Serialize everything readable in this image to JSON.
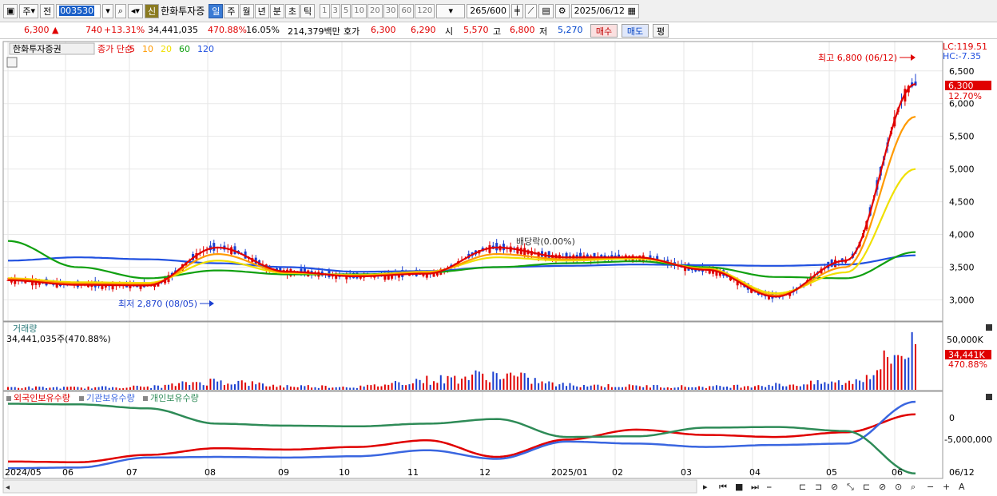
{
  "toolbar": {
    "market": "주",
    "prev_label": "전",
    "stock_code": "003530",
    "stock_badge": "신",
    "stock_name": "한화투자증",
    "periods": [
      "일",
      "주",
      "월",
      "년",
      "분",
      "초",
      "틱"
    ],
    "active_period": "일",
    "intervals": [
      "1",
      "3",
      "5",
      "10",
      "20",
      "30",
      "60",
      "120"
    ],
    "count_current": "265",
    "count_total": "/600",
    "date": "2025/06/12"
  },
  "quote": {
    "price": "6,300",
    "change": "740",
    "change_pct": "+13.31%",
    "volume": "34,441,035",
    "volume_ratio": "470.88%",
    "turnover": "16.05%",
    "amount": "214,379백만",
    "ask_label": "호가",
    "ask": "6,300",
    "bid": "6,290",
    "open_label": "시",
    "open": "5,570",
    "high_label": "고",
    "high": "6,800",
    "low_label": "저",
    "low": "5,270",
    "buy_label": "매수",
    "sell_label": "매도",
    "avg_label": "평"
  },
  "price_panel": {
    "title": "한화투자증권",
    "legend_prefix": "종가 단순",
    "ma_periods": [
      "5",
      "10",
      "20",
      "60",
      "120"
    ],
    "lc_label": "LC:119.51",
    "hc_label": "HC:-7.35",
    "high_annotation": "최고 6,800 (06/12)",
    "low_annotation": "최저 2,870 (08/05)",
    "mid_annotation": "배당락(0.00%)",
    "current_price_label": "6,300",
    "current_pct_label": "12.70%",
    "y_ticks": [
      "6,500",
      "6,000",
      "5,500",
      "5,000",
      "4,500",
      "4,000",
      "3,500",
      "3,000"
    ]
  },
  "volume_panel": {
    "title": "거래량",
    "summary": "34,441,035주(470.88%)",
    "y_tick": "50,000K",
    "current_label": "34,441K",
    "current_pct": "470.88%"
  },
  "holdings_panel": {
    "series_names": [
      "외국인보유수량",
      "기관보유수량",
      "개인보유수량"
    ],
    "y_ticks": [
      "0",
      "-5,000,000"
    ]
  },
  "x_axis": {
    "labels": [
      "2024/05",
      "06",
      "07",
      "08",
      "09",
      "10",
      "11",
      "12",
      "2025/01",
      "02",
      "03",
      "04",
      "05",
      "06"
    ],
    "end_label": "06/12"
  },
  "colors": {
    "up": "#e00000",
    "down": "#1a3fd0",
    "ma5": "#e00000",
    "ma10": "#ff9a00",
    "ma20": "#f0e000",
    "ma60": "#10a010",
    "ma120": "#2050e0",
    "foreign": "#e00000",
    "institution": "#3a66e0",
    "individual": "#2e8b57"
  },
  "chart_data": [
    {
      "type": "line",
      "title": "한화투자증권",
      "x": [
        "2024/05",
        "06",
        "07",
        "08",
        "09",
        "10",
        "11",
        "12",
        "2025/01",
        "02",
        "03",
        "04",
        "05",
        "06"
      ],
      "series": [
        {
          "name": "5",
          "values": [
            3300,
            3230,
            3220,
            3800,
            3430,
            3360,
            3400,
            3800,
            3650,
            3650,
            3460,
            3050,
            3600,
            6300
          ]
        },
        {
          "name": "10",
          "values": [
            3320,
            3250,
            3240,
            3700,
            3420,
            3370,
            3420,
            3700,
            3620,
            3650,
            3470,
            3070,
            3500,
            5800
          ]
        },
        {
          "name": "20",
          "values": [
            3330,
            3270,
            3260,
            3600,
            3410,
            3380,
            3430,
            3650,
            3600,
            3630,
            3480,
            3100,
            3420,
            5000
          ]
        },
        {
          "name": "60",
          "values": [
            3900,
            3500,
            3330,
            3450,
            3390,
            3390,
            3420,
            3500,
            3560,
            3590,
            3500,
            3350,
            3330,
            3730
          ]
        },
        {
          "name": "120",
          "values": [
            3600,
            3650,
            3620,
            3560,
            3500,
            3430,
            3440,
            3500,
            3520,
            3540,
            3530,
            3520,
            3540,
            3680
          ]
        }
      ],
      "ylim": [
        2700,
        6900
      ]
    },
    {
      "type": "bar",
      "title": "거래량",
      "x": [
        "2024/05",
        "06",
        "07",
        "08",
        "09",
        "10",
        "11",
        "12",
        "2025/01",
        "02",
        "03",
        "04",
        "05",
        "06"
      ],
      "values": [
        2000,
        1800,
        2500,
        7000,
        3000,
        2500,
        8000,
        12000,
        4000,
        3000,
        2500,
        4000,
        6000,
        34441
      ],
      "ylim": [
        0,
        55000
      ]
    },
    {
      "type": "line",
      "x": [
        "2024/05",
        "06",
        "07",
        "08",
        "09",
        "10",
        "11",
        "12",
        "2025/01",
        "02",
        "03",
        "04",
        "05",
        "06"
      ],
      "series": [
        {
          "name": "외국인보유수량",
          "values": [
            -7200000,
            -7300000,
            -6200000,
            -5200000,
            -5400000,
            -5000000,
            -4000000,
            -6500000,
            -3900000,
            -2400000,
            -3200000,
            -3500000,
            -2800000,
            -100000
          ]
        },
        {
          "name": "기관보유수량",
          "values": [
            -8200000,
            -8100000,
            -6600000,
            -6500000,
            -6600000,
            -6400000,
            -5500000,
            -6800000,
            -4200000,
            -4500000,
            -5000000,
            -4700000,
            -4500000,
            1800000
          ]
        },
        {
          "name": "개인보유수량",
          "values": [
            1500000,
            1400000,
            800000,
            -1500000,
            -1800000,
            -1900000,
            -1500000,
            -800000,
            -3500000,
            -3400000,
            -2100000,
            -2000000,
            -2600000,
            -9000000
          ]
        }
      ],
      "ylim": [
        -9500000,
        3000000
      ]
    }
  ]
}
